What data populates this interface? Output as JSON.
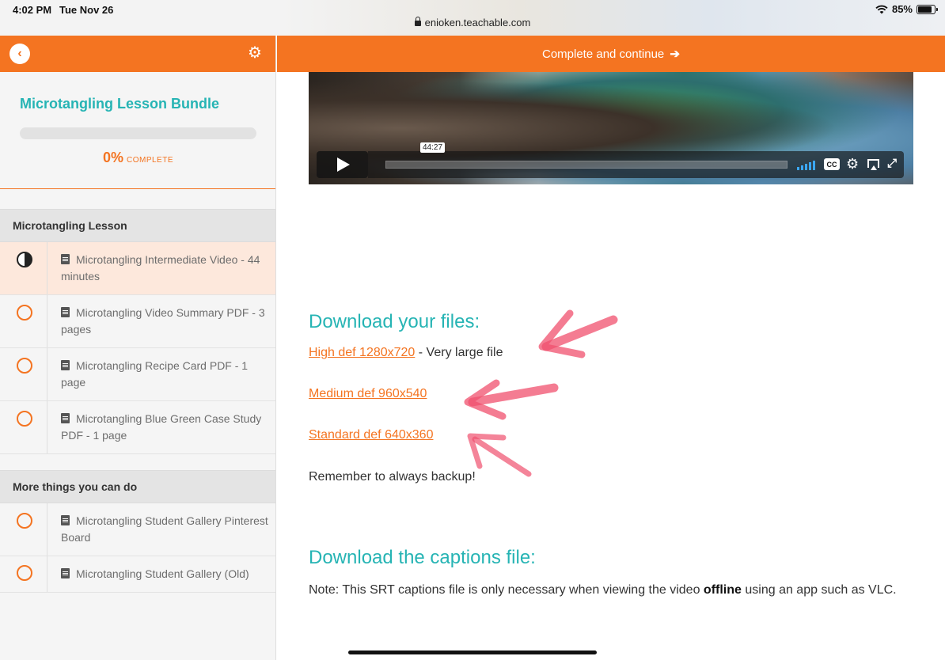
{
  "status_bar": {
    "time": "4:02 PM",
    "date": "Tue Nov 26",
    "url": "enioken.teachable.com",
    "battery": "85%",
    "battery_level": 0.85
  },
  "sidebar": {
    "course_title": "Microtangling Lesson Bundle",
    "progress_percent": "0%",
    "progress_label": "COMPLETE",
    "progress_value": 0,
    "sections": [
      {
        "title": "Microtangling Lesson",
        "lessons": [
          {
            "label": "Microtangling Intermediate Video - 44 minutes",
            "status": "in-progress"
          },
          {
            "label": "Microtangling Video Summary PDF - 3 pages",
            "status": "not-started"
          },
          {
            "label": "Microtangling Recipe Card PDF - 1 page",
            "status": "not-started"
          },
          {
            "label": "Microtangling Blue Green Case Study PDF - 1 page",
            "status": "not-started"
          }
        ]
      },
      {
        "title": "More things you can do",
        "lessons": [
          {
            "label": "Microtangling Student Gallery Pinterest Board",
            "status": "not-started"
          },
          {
            "label": "Microtangling Student Gallery (Old)",
            "status": "not-started"
          }
        ]
      }
    ]
  },
  "topbar": {
    "complete_label": "Complete and continue"
  },
  "video": {
    "time_tooltip": "44:27",
    "cc_label": "CC"
  },
  "main": {
    "download_heading": "Download your files:",
    "links": [
      {
        "label": "High def 1280x720",
        "note": " - Very large file"
      },
      {
        "label": "Medium def 960x540",
        "note": ""
      },
      {
        "label": "Standard def 640x360",
        "note": ""
      }
    ],
    "backup_text": "Remember to always backup!",
    "captions_heading": "Download the captions file:",
    "captions_note_before": "Note: This SRT captions file is only necessary when viewing the video ",
    "captions_note_bold": "offline",
    "captions_note_after": " using an app such as VLC."
  },
  "colors": {
    "accent_orange": "#f47421",
    "heading_teal": "#26b4b4",
    "annotation_red": "#f0506e"
  }
}
